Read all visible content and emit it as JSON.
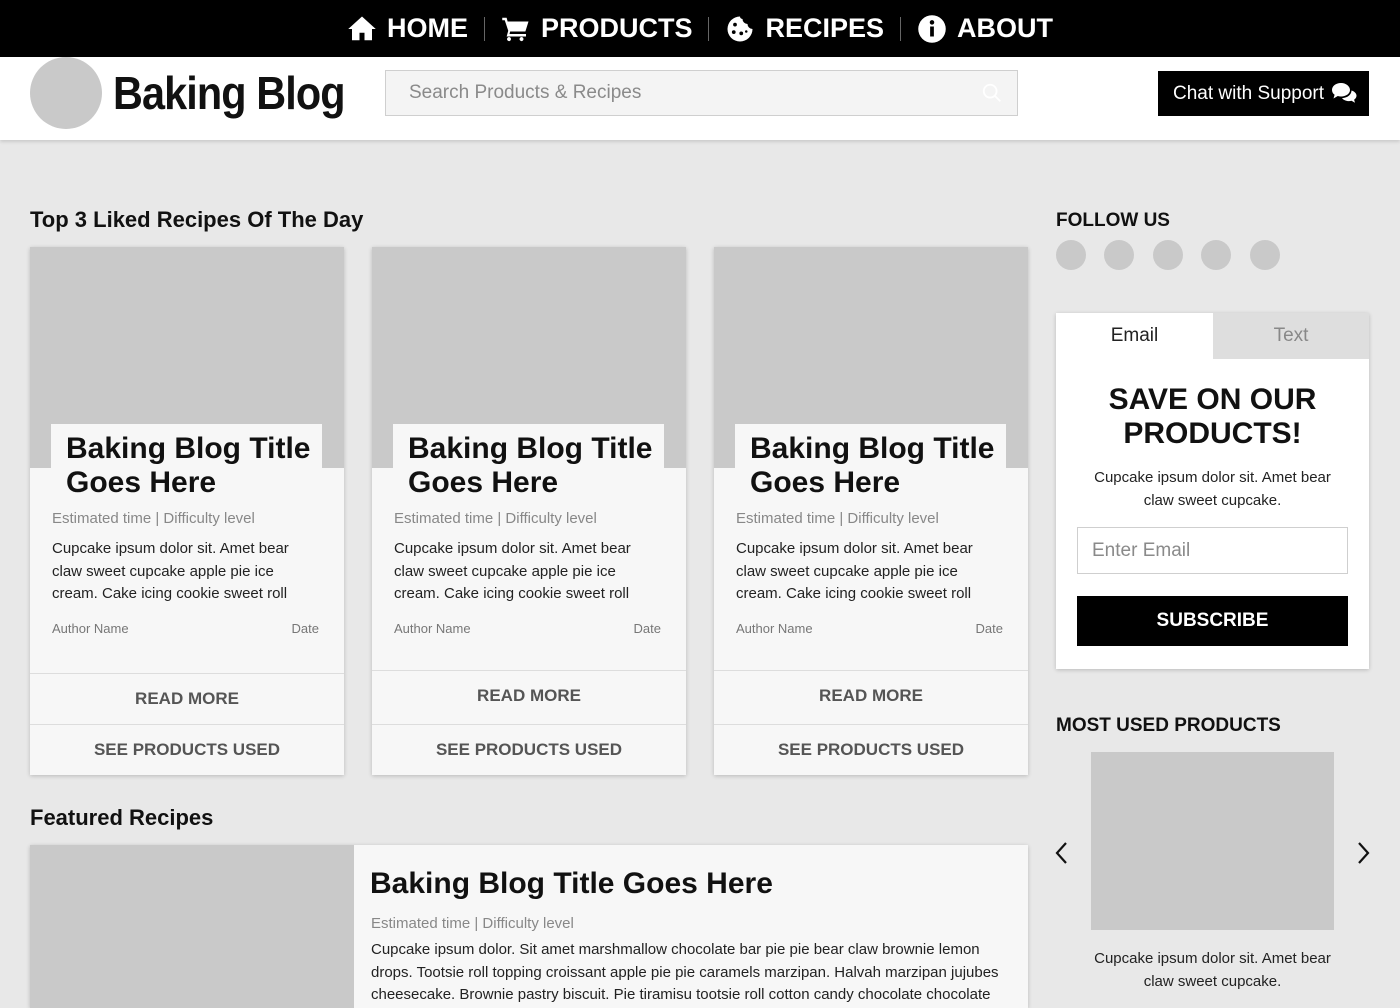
{
  "nav": {
    "items": [
      {
        "label": "HOME",
        "icon": "home-icon"
      },
      {
        "label": "PRODUCTS",
        "icon": "cart-icon"
      },
      {
        "label": "RECIPES",
        "icon": "cookie-icon"
      },
      {
        "label": "ABOUT",
        "icon": "info-icon"
      }
    ]
  },
  "header": {
    "brand": "Baking Blog",
    "search_placeholder": "Search Products & Recipes",
    "chat_label": "Chat with Support"
  },
  "top_section": {
    "title": "Top 3 Liked Recipes Of The Day",
    "cards": [
      {
        "title": "Baking Blog Title Goes Here",
        "meta": "Estimated time | Difficulty level",
        "desc": "Cupcake ipsum dolor sit. Amet bear claw sweet cupcake apple pie ice cream. Cake icing cookie sweet roll",
        "author": "Author Name",
        "date": "Date",
        "read_more": "READ MORE",
        "see_products": "SEE PRODUCTS USED"
      },
      {
        "title": "Baking Blog Title Goes Here",
        "meta": "Estimated time | Difficulty level",
        "desc": "Cupcake ipsum dolor sit. Amet bear claw sweet cupcake apple pie ice cream. Cake icing cookie sweet roll",
        "author": "Author Name",
        "date": "Date",
        "read_more": "READ MORE",
        "see_products": "SEE PRODUCTS USED"
      },
      {
        "title": "Baking Blog Title Goes Here",
        "meta": "Estimated time | Difficulty level",
        "desc": "Cupcake ipsum dolor sit. Amet bear claw sweet cupcake apple pie ice cream. Cake icing cookie sweet roll",
        "author": "Author Name",
        "date": "Date",
        "read_more": "READ MORE",
        "see_products": "SEE PRODUCTS USED"
      }
    ]
  },
  "featured": {
    "title": "Featured Recipes",
    "post_title": "Baking Blog Title Goes Here",
    "meta": "Estimated time | Difficulty level",
    "desc": "Cupcake ipsum dolor. Sit amet marshmallow chocolate bar pie pie bear claw brownie lemon drops. Tootsie roll topping croissant apple pie pie caramels marzipan. Halvah marzipan jujubes cheesecake. Brownie pastry biscuit. Pie tiramisu tootsie roll cotton candy chocolate chocolate"
  },
  "sidebar": {
    "follow_title": "FOLLOW US",
    "subscribe": {
      "tabs": [
        "Email",
        "Text"
      ],
      "title": "SAVE ON OUR PRODUCTS!",
      "desc": "Cupcake ipsum dolor sit. Amet bear claw sweet cupcake.",
      "email_placeholder": "Enter Email",
      "button": "SUBSCRIBE"
    },
    "products_title": "MOST USED PRODUCTS",
    "product_desc": "Cupcake ipsum dolor sit. Amet bear claw sweet cupcake."
  },
  "colors": {
    "nav_bg": "#000000",
    "page_bg": "#e8e8e8",
    "placeholder_gray": "#c9c9c9",
    "button_bg": "#000000"
  }
}
